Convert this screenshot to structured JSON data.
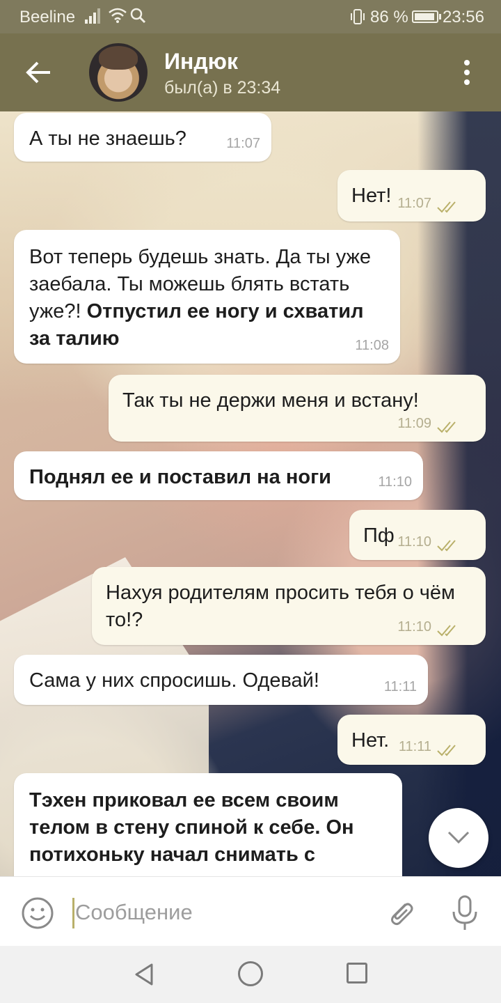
{
  "status_bar": {
    "carrier": "Beeline",
    "battery": "86 %",
    "time": "23:56",
    "icons": [
      "signal-icon",
      "wifi-icon",
      "search-icon",
      "vibrate-icon",
      "battery-icon"
    ]
  },
  "header": {
    "name": "Индюк",
    "status": "был(а) в 23:34",
    "icons": [
      "back-arrow-icon",
      "more-vert-icon"
    ]
  },
  "messages": [
    {
      "dir": "in",
      "text": "А ты не знаешь?",
      "time": "11:07"
    },
    {
      "dir": "out",
      "text": "Нет!",
      "time": "11:07",
      "read": true
    },
    {
      "dir": "in",
      "text_plain": "Вот теперь будешь знать. Да ты уже заебала. Ты можешь блять встать уже?!",
      "text_bold": "Отпустил ее ногу и схватил за талию",
      "time": "11:08"
    },
    {
      "dir": "out",
      "text": "Так ты не держи меня и встану!",
      "time": "11:09",
      "read": true
    },
    {
      "dir": "in",
      "text_bold": "Поднял ее и поставил на ноги",
      "time": "11:10"
    },
    {
      "dir": "out",
      "text": "Пф",
      "time": "11:10",
      "read": true
    },
    {
      "dir": "out",
      "text": "Нахуя родителям просить тебя о чём то!?",
      "time": "11:10",
      "read": true
    },
    {
      "dir": "in",
      "text": "Сама у них спросишь. Одевай!",
      "time": "11:11"
    },
    {
      "dir": "out",
      "text": "Нет.",
      "time": "11:11",
      "read": true
    },
    {
      "dir": "in",
      "text_bold": "Тэхен приковал ее всем своим телом в стену спиной к себе. Он потихоньку начал снимать с"
    }
  ],
  "input": {
    "placeholder": "Сообщение",
    "icons": [
      "emoji-icon",
      "attach-icon",
      "mic-icon"
    ]
  },
  "colors": {
    "header": "#77714f",
    "status_bar": "#7f7a5d",
    "incoming_bubble": "#ffffff",
    "outgoing_bubble": "#fbf8ea",
    "read_check": "#b9b06a"
  }
}
